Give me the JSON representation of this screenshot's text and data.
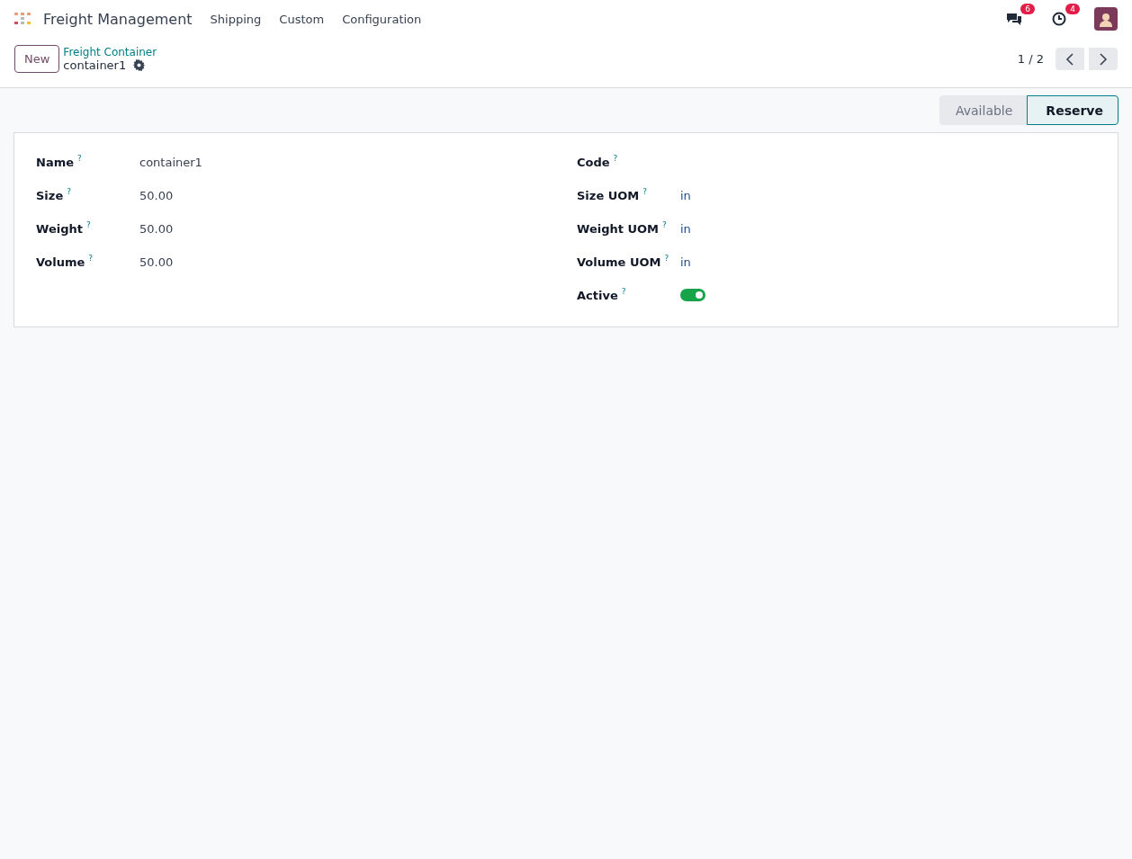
{
  "navbar": {
    "app_name": "Freight Management",
    "menu": [
      "Shipping",
      "Custom",
      "Configuration"
    ],
    "messages_badge": "6",
    "activities_badge": "4"
  },
  "control_panel": {
    "new_button": "New",
    "breadcrumb": "Freight Container",
    "record_name": "container1",
    "pager": "1 / 2"
  },
  "statusbar": [
    {
      "label": "Available",
      "selected": false
    },
    {
      "label": "Reserve",
      "selected": true
    }
  ],
  "left_fields": [
    {
      "kind": "text",
      "label": "Name",
      "help": "?",
      "value": "container1"
    },
    {
      "kind": "text",
      "label": "Size",
      "help": "?",
      "value": "50.00"
    },
    {
      "kind": "text",
      "label": "Weight",
      "help": "?",
      "value": "50.00"
    },
    {
      "kind": "text",
      "label": "Volume",
      "help": "?",
      "value": "50.00"
    }
  ],
  "right_fields": [
    {
      "kind": "text",
      "label": "Code",
      "help": "?"
    },
    {
      "kind": "link",
      "label": "Size UOM",
      "help": "?",
      "value": "in"
    },
    {
      "kind": "link",
      "label": "Weight UOM",
      "help": "?",
      "value": "in"
    },
    {
      "kind": "link",
      "label": "Volume UOM",
      "help": "?",
      "value": "in"
    },
    {
      "kind": "toggle",
      "label": "Active",
      "help": "?",
      "on": true
    }
  ]
}
